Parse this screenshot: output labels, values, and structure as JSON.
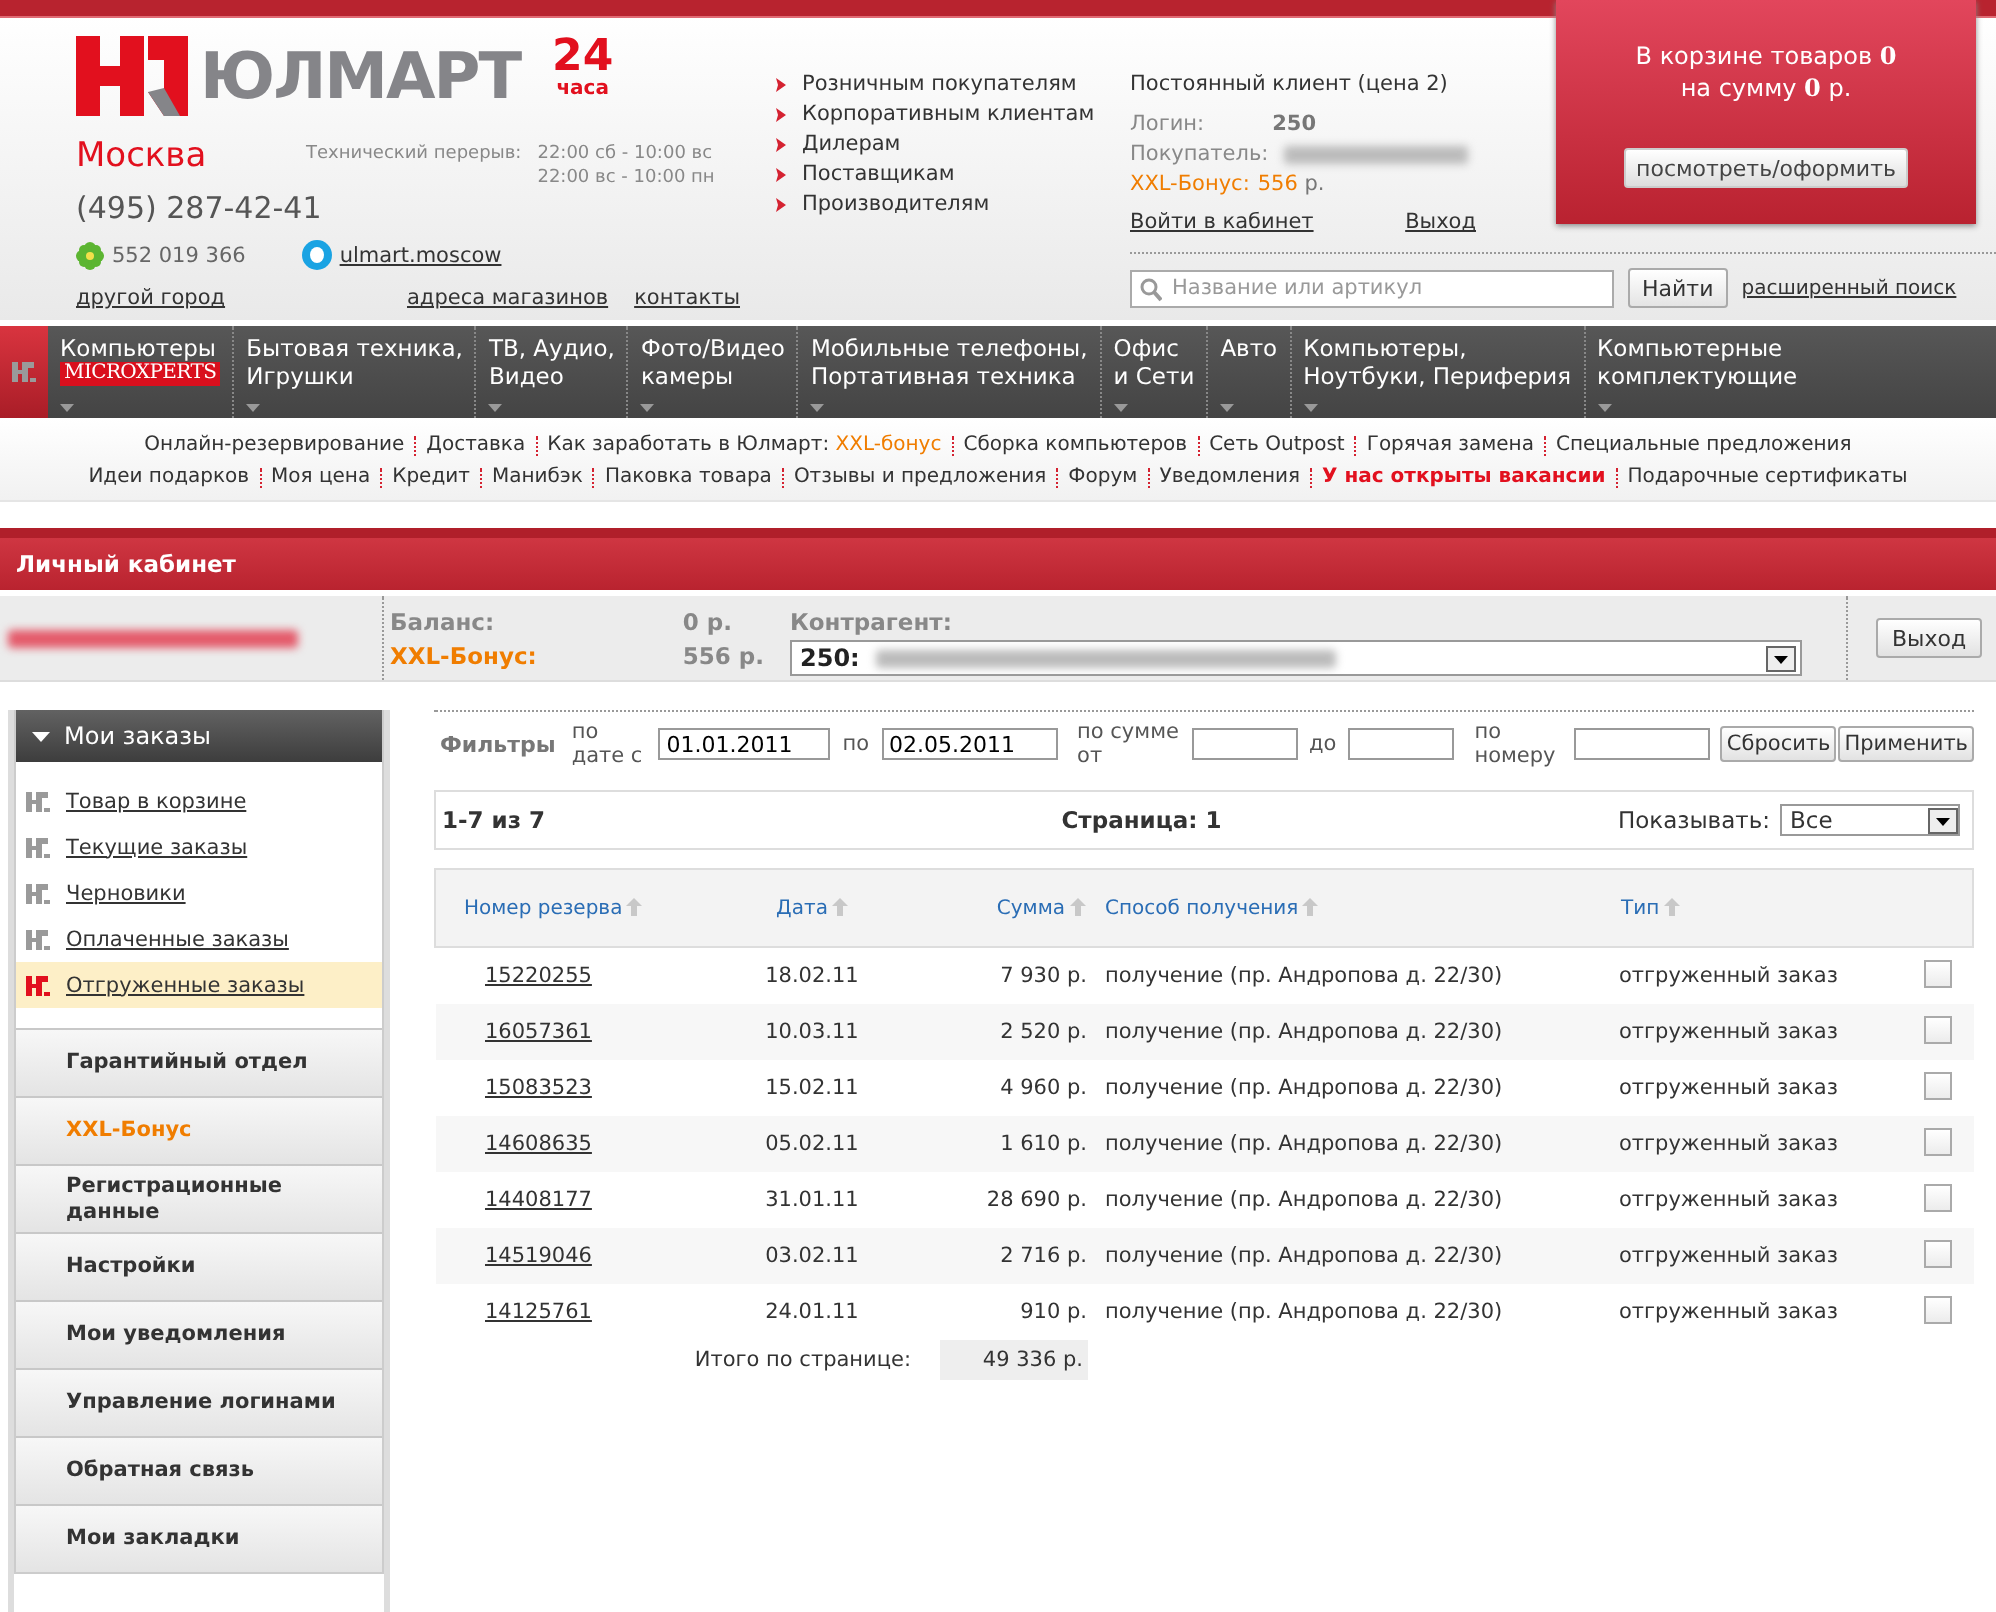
{
  "header": {
    "logo_text": "ЮЛМАРТ",
    "hours": "24",
    "hours_unit": "часа",
    "city": "Москва",
    "phone": "(495) 287-42-41",
    "break_label": "Технический перерыв:",
    "break_times": [
      "22:00 сб - 10:00 вс",
      "22:00 вс - 10:00 пн"
    ],
    "icq": "552 019 366",
    "skype": "ulmart.moscow",
    "links": [
      "другой город",
      "адреса магазинов",
      "контакты"
    ]
  },
  "nav_links": [
    "Розничным покупателям",
    "Корпоративным клиентам",
    "Дилерам",
    "Поставщикам",
    "Производителям"
  ],
  "client": {
    "status": "Постоянный клиент (цена 2)",
    "login_label": "Логин:",
    "login": "250",
    "buyer_label": "Покупатель:",
    "bonus_label": "XXL-Бонус:",
    "bonus": "556",
    "currency": "р.",
    "enter_link": "Войти в кабинет",
    "logout_link": "Выход"
  },
  "cart": {
    "lines": [
      "В корзине товаров **0**",
      "на сумму **0** р."
    ],
    "button": "посмотреть/оформить"
  },
  "search": {
    "placeholder": "Название или артикул",
    "button": "Найти",
    "advanced_link": "расширенный поиск"
  },
  "categories": [
    {
      "label": "Компьютеры",
      "badge": "MICROXPERTS"
    },
    {
      "label": "Бытовая техника,\nИгрушки"
    },
    {
      "label": "ТВ, Аудио,\nВидео"
    },
    {
      "label": "Фото/Видео\nкамеры"
    },
    {
      "label": "Мобильные телефоны,\nПортативная техника"
    },
    {
      "label": "Офис\nи Сети"
    },
    {
      "label": "Авто"
    },
    {
      "label": "Компьютеры,\nНоутбуки, Периферия"
    },
    {
      "label": "Компьютерные\nкомплектующие"
    }
  ],
  "sub_links": [
    [
      {
        "label": "Онлайн-резервирование",
        "kind": "normal"
      },
      {
        "label": "Доставка",
        "kind": "normal"
      },
      {
        "label": "Как заработать в Юлмарт:",
        "accent": "XXL-бонус",
        "kind": "normal"
      },
      {
        "label": "Сборка компьютеров",
        "kind": "normal"
      },
      {
        "label": "Сеть Outpost",
        "kind": "normal"
      },
      {
        "label": "Горячая замена",
        "kind": "normal"
      },
      {
        "label": "Специальные предложения",
        "kind": "normal"
      }
    ],
    [
      {
        "label": "Идеи подарков",
        "kind": "normal"
      },
      {
        "label": "Моя цена",
        "kind": "normal"
      },
      {
        "label": "Кредит",
        "kind": "normal"
      },
      {
        "label": "Манибэк",
        "kind": "normal"
      },
      {
        "label": "Паковка товара",
        "kind": "normal"
      },
      {
        "label": "Отзывы и предложения",
        "kind": "normal"
      },
      {
        "label": "Форум",
        "kind": "normal"
      },
      {
        "label": "Уведомления",
        "kind": "normal"
      },
      {
        "label": "У нас открыты вакансии",
        "kind": "alert"
      },
      {
        "label": "Подарочные сертификаты",
        "kind": "normal"
      }
    ]
  ],
  "section_title": "Личный кабинет",
  "account": {
    "balance_label": "Баланс:",
    "balance": "0 р.",
    "bonus_label": "XXL-Бонус:",
    "bonus": "556 р.",
    "contragent_label": "Контрагент:",
    "contragent": "250:",
    "logout": "Выход"
  },
  "sidebar": {
    "header": "Мои заказы",
    "expanded": true,
    "items": [
      {
        "label": "Товар в корзине",
        "selected": false
      },
      {
        "label": "Текущие заказы",
        "selected": false
      },
      {
        "label": "Черновики",
        "selected": false
      },
      {
        "label": "Оплаченные заказы",
        "selected": false
      },
      {
        "label": "Отгруженные заказы",
        "selected": true
      }
    ],
    "sections": [
      {
        "label": "Гарантийный отдел",
        "kind": "normal"
      },
      {
        "label": "XXL-Бонус",
        "kind": "accent"
      },
      {
        "label": "Регистрационные данные",
        "kind": "normal"
      },
      {
        "label": "Настройки",
        "kind": "normal"
      },
      {
        "label": "Мои уведомления",
        "kind": "normal"
      },
      {
        "label": "Управление логинами",
        "kind": "normal"
      },
      {
        "label": "Обратная связь",
        "kind": "normal"
      },
      {
        "label": "Мои закладки",
        "kind": "normal"
      }
    ]
  },
  "filters": {
    "label": "Фильтры",
    "date_label": "по дате с",
    "date_from": "01.01.2011",
    "date_to_label": "по",
    "date_to": "02.05.2011",
    "sum_label": "по сумме от",
    "sum_to_label": "до",
    "number_label": "по номеру",
    "reset": "Сбросить",
    "apply": "Применить"
  },
  "pager": {
    "range": "1-7 из 7",
    "page": "Страница: 1",
    "show_label": "Показывать:",
    "show_value": "Все"
  },
  "table": {
    "columns": [
      "Номер резерва",
      "Дата",
      "Сумма",
      "Способ получения",
      "Тип"
    ],
    "rows": [
      {
        "number": "15220255",
        "date": "18.02.11",
        "sum": "7 930 р.",
        "method": "получение (пр. Андропова д. 22/30)",
        "type": "отгруженный заказ",
        "checked": false
      },
      {
        "number": "16057361",
        "date": "10.03.11",
        "sum": "2 520 р.",
        "method": "получение (пр. Андропова д. 22/30)",
        "type": "отгруженный заказ",
        "checked": false
      },
      {
        "number": "15083523",
        "date": "15.02.11",
        "sum": "4 960 р.",
        "method": "получение (пр. Андропова д. 22/30)",
        "type": "отгруженный заказ",
        "checked": false
      },
      {
        "number": "14608635",
        "date": "05.02.11",
        "sum": "1 610 р.",
        "method": "получение (пр. Андропова д. 22/30)",
        "type": "отгруженный заказ",
        "checked": false
      },
      {
        "number": "14408177",
        "date": "31.01.11",
        "sum": "28 690 р.",
        "method": "получение (пр. Андропова д. 22/30)",
        "type": "отгруженный заказ",
        "checked": false
      },
      {
        "number": "14519046",
        "date": "03.02.11",
        "sum": "2 716 р.",
        "method": "получение (пр. Андропова д. 22/30)",
        "type": "отгруженный заказ",
        "checked": false
      },
      {
        "number": "14125761",
        "date": "24.01.11",
        "sum": "910 р.",
        "method": "получение (пр. Андропова д. 22/30)",
        "type": "отгруженный заказ",
        "checked": false
      }
    ],
    "total_label": "Итого по странице:",
    "total": "49 336 р."
  }
}
